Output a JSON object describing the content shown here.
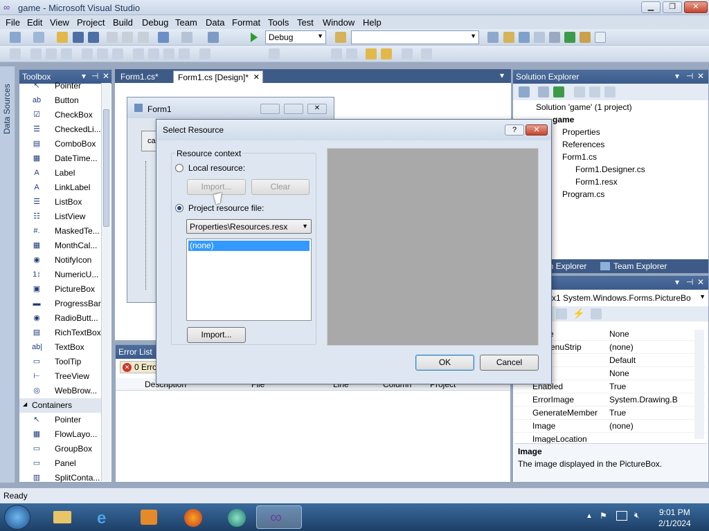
{
  "window": {
    "title": "game - Microsoft Visual Studio"
  },
  "menu": [
    "File",
    "Edit",
    "View",
    "Project",
    "Build",
    "Debug",
    "Team",
    "Data",
    "Format",
    "Tools",
    "Test",
    "Window",
    "Help"
  ],
  "toolbar": {
    "config": "Debug",
    "platform": ""
  },
  "left_strip": {
    "label": "Data Sources"
  },
  "toolbox": {
    "title": "Toolbox",
    "items": [
      "Pointer",
      "Button",
      "CheckBox",
      "CheckedLi...",
      "ComboBox",
      "DateTime...",
      "Label",
      "LinkLabel",
      "ListBox",
      "ListView",
      "MaskedTe...",
      "MonthCal...",
      "NotifyIcon",
      "NumericU...",
      "PictureBox",
      "ProgressBar",
      "RadioButt...",
      "RichTextBox",
      "TextBox",
      "ToolTip",
      "TreeView",
      "WebBrow..."
    ],
    "section": "Containers",
    "container_items": [
      "Pointer",
      "FlowLayo...",
      "GroupBox",
      "Panel",
      "SplitConta..."
    ]
  },
  "doc_tabs": [
    "Form1.cs*",
    "Form1.cs [Design]*"
  ],
  "designer_form": {
    "title": "Form1",
    "button_text": "ca"
  },
  "error_list": {
    "title": "Error List",
    "count": "0 Erro",
    "columns": [
      "Description",
      "File",
      "Line",
      "Column",
      "Project"
    ]
  },
  "solution_explorer": {
    "title": "Solution Explorer",
    "items": [
      "Solution 'game' (1 project)",
      "game",
      "Properties",
      "References",
      "Form1.cs",
      "Form1.Designer.cs",
      "Form1.resx",
      "Program.cs"
    ],
    "tabs": [
      "Solution Explorer",
      "Team Explorer"
    ],
    "tab_visible": "on Explorer"
  },
  "properties": {
    "object": "x1  System.Windows.Forms.PictureBo",
    "rows": [
      {
        "name": "rStyle",
        "value": "None"
      },
      {
        "name": "extMenuStrip",
        "value": "(none)"
      },
      {
        "name": "r",
        "value": "Default"
      },
      {
        "name": "",
        "value": "None"
      },
      {
        "name": "Enabled",
        "value": "True"
      },
      {
        "name": "ErrorImage",
        "value": "System.Drawing.B"
      },
      {
        "name": "GenerateMember",
        "value": "True"
      },
      {
        "name": "Image",
        "value": "(none)"
      },
      {
        "name": "ImageLocation",
        "value": ""
      }
    ],
    "desc_title": "Image",
    "desc_text": "The image displayed in the PictureBox."
  },
  "status": {
    "text": "Ready"
  },
  "taskbar": {
    "time": "9:01 PM",
    "date": "2/1/2024"
  },
  "dialog": {
    "title": "Select Resource",
    "help_btn": "?",
    "group_label": "Resource context",
    "local_label": "Local resource:",
    "import_disabled": "Import...",
    "clear_label": "Clear",
    "project_label": "Project resource file:",
    "resource_file": "Properties\\Resources.resx",
    "list_items": [
      "(none)"
    ],
    "import_label": "Import...",
    "ok_label": "OK",
    "cancel_label": "Cancel"
  }
}
